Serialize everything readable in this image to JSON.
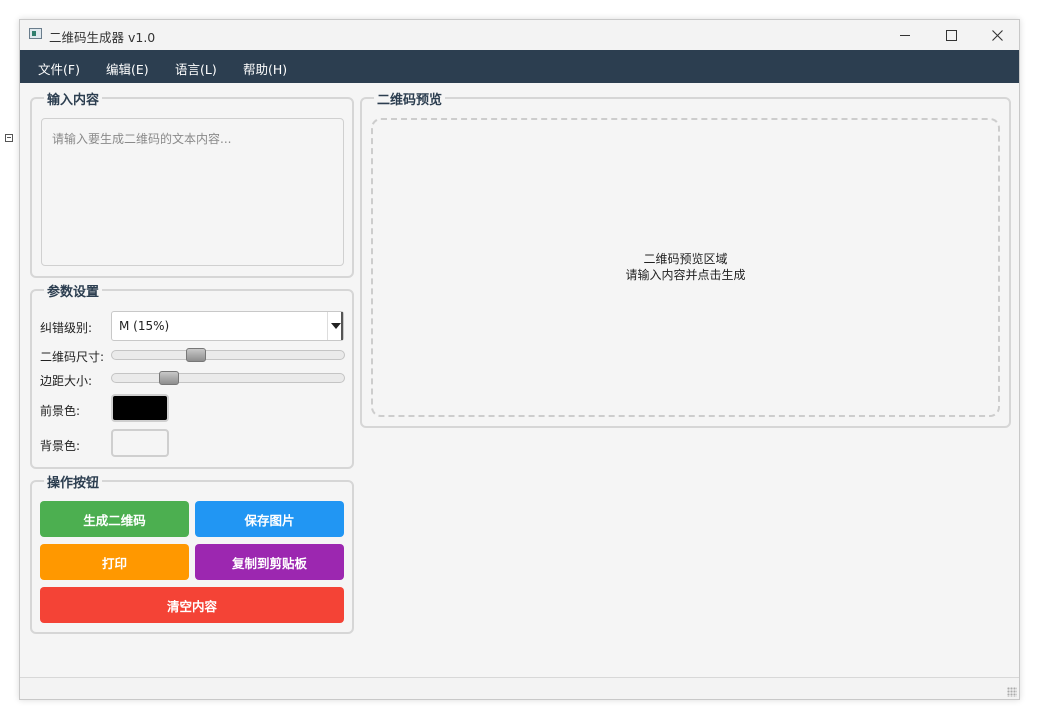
{
  "window": {
    "title": "二维码生成器 v1.0",
    "icons": {
      "app": "app-icon",
      "minimize": "minimize-icon",
      "maximize": "maximize-icon",
      "close": "close-icon"
    }
  },
  "menu": {
    "items": [
      {
        "label": "文件(F)"
      },
      {
        "label": "编辑(E)"
      },
      {
        "label": "语言(L)"
      },
      {
        "label": "帮助(H)"
      }
    ]
  },
  "input_group": {
    "title": "输入内容",
    "placeholder": "请输入要生成二维码的文本内容..."
  },
  "params_group": {
    "title": "参数设置",
    "error_level_label": "纠错级别:",
    "error_level_value": "M (15%)",
    "size_label": "二维码尺寸:",
    "size_slider_fraction": 0.35,
    "margin_label": "边距大小:",
    "margin_slider_fraction": 0.22,
    "fg_label": "前景色:",
    "fg_color": "#000000",
    "bg_label": "背景色:",
    "bg_color": "#f5f5f5"
  },
  "actions_group": {
    "title": "操作按钮",
    "buttons": [
      {
        "label": "生成二维码",
        "color": "#4caf50"
      },
      {
        "label": "保存图片",
        "color": "#2196f3"
      },
      {
        "label": "打印",
        "color": "#ff9800"
      },
      {
        "label": "复制到剪贴板",
        "color": "#9c27b0"
      },
      {
        "label": "清空内容",
        "color": "#f44336"
      }
    ]
  },
  "preview_group": {
    "title": "二维码预览",
    "line1": "二维码预览区域",
    "line2": "请输入内容并点击生成"
  },
  "colors": {
    "menubar": "#2c3e50",
    "group_title": "#2c3e50"
  }
}
